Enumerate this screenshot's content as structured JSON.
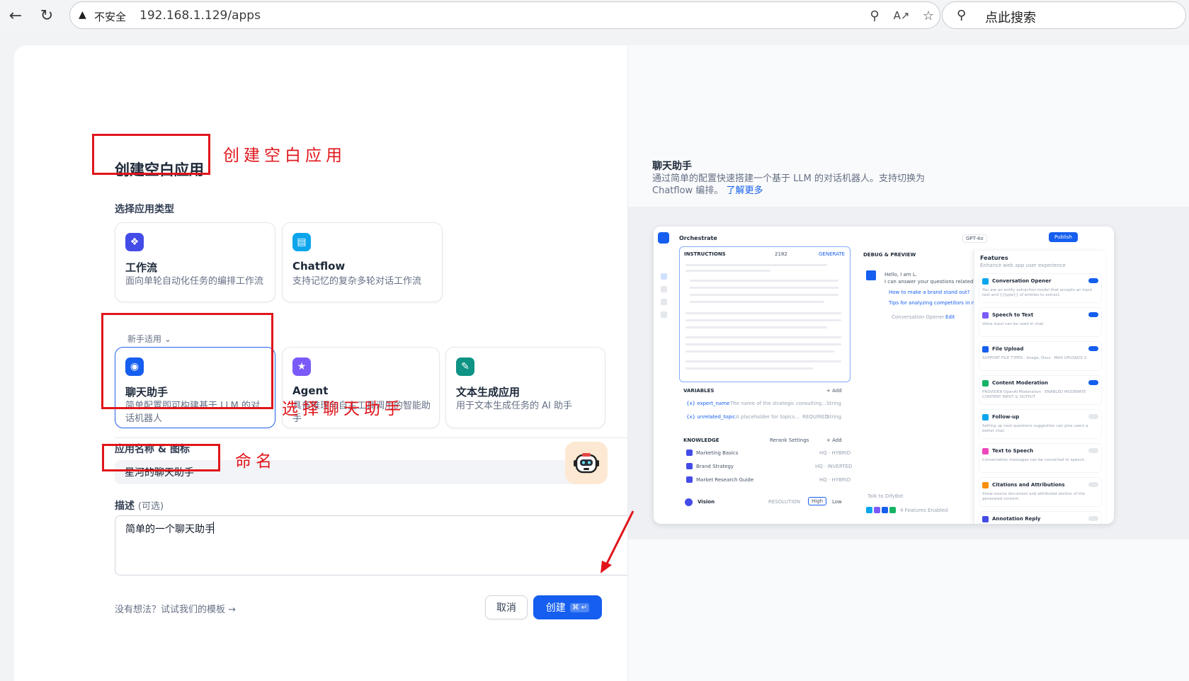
{
  "browser": {
    "insecure_label": "不安全",
    "url": "192.168.1.129/apps",
    "search_placeholder": "点此搜索"
  },
  "dialog": {
    "title": "创建空白应用",
    "app_type_label": "选择应用类型",
    "beginner_label": "新手适用",
    "top_types": [
      {
        "name": "工作流",
        "desc": "面向单轮自动化任务的编排工作流",
        "color": "#444ce7"
      },
      {
        "name": "Chatflow",
        "desc": "支持记忆的复杂多轮对话工作流",
        "color": "#0ba5ec"
      }
    ],
    "beginner_types": [
      {
        "name": "聊天助手",
        "desc": "简单配置即可构建基于 LLM 的对话机器人",
        "color": "#155eef"
      },
      {
        "name": "Agent",
        "desc": "具备推理与自主工具调用的智能助手",
        "color": "#7a5af8"
      },
      {
        "name": "文本生成应用",
        "desc": "用于文本生成任务的 AI 助手",
        "color": "#0e9384"
      }
    ],
    "name_label": "应用名称 & 图标",
    "name_value": "星河的聊天助手",
    "desc_label": "描述",
    "desc_optional": "(可选)",
    "desc_value": "简单的一个聊天助手",
    "template_link": "没有想法？试试我们的模板 →",
    "cancel_label": "取消",
    "create_label": "创建",
    "create_shortcut": "⌘ ↵"
  },
  "annotations": {
    "title_note": "创建空白应用",
    "select_note": "选择聊天助手",
    "name_note": "命名"
  },
  "preview": {
    "title": "聊天助手",
    "desc": "通过简单的配置快速搭建一个基于 LLM 的对话机器人。支持切换为 Chatflow 编排。",
    "learn_more": "了解更多",
    "shot": {
      "orchestrate": "Orchestrate",
      "model": "GPT-4o",
      "publish": "Publish",
      "instructions": "INSTRUCTIONS",
      "token_count": "2182",
      "generate": "GENERATE",
      "debug": "DEBUG & PREVIEW",
      "greeting": "Hello, I am L.",
      "greeting2": "I can answer your questions related",
      "suggest1": "How to make a brand stand out?",
      "suggest2": "Tips for analyzing competitors in market",
      "opener": "Conversation Opener",
      "edit": "Edit",
      "variables": "VARIABLES",
      "add": "+ Add",
      "var1": "{x} expert_name",
      "var1_desc": "The name of the strategic consulting...",
      "var2": "{x} unrelated_topic",
      "var2_desc": "A placeholder for topics...",
      "required": "REQUIRED",
      "string_type": "String",
      "knowledge": "KNOWLEDGE",
      "rerank": "Rerank Settings",
      "kb": [
        "Marketing Basics",
        "Brand Strategy",
        "Market Research Guide"
      ],
      "kb_tags": [
        "HQ · HYBRID",
        "HQ · INVERTED",
        "HQ · HYBRID"
      ],
      "vision": "Vision",
      "resolution": "RESOLUTION",
      "high": "High",
      "low": "Low",
      "talk": "Talk to DifyBot",
      "features_enabled": "4 Features Enabled",
      "features": "Features",
      "features_sub": "Enhance web app user experience",
      "feature_list": [
        {
          "name": "Conversation Opener",
          "desc": "You are an entity extraction model that accepts an input text and {{type}} of entities to extract.",
          "color": "#0ba5ec",
          "on": true
        },
        {
          "name": "Speech to Text",
          "desc": "Voice input can be used in chat.",
          "color": "#7a5af8",
          "on": true
        },
        {
          "name": "File Upload",
          "desc": "SUPPORT FILE TYPES · Image, Docs · MAX UPLOADS 3",
          "color": "#155eef",
          "on": true
        },
        {
          "name": "Content Moderation",
          "desc": "PROVIDER OpenAI Moderation · ENABLED MODERATE CONTENT INPUT & OUTPUT",
          "color": "#16b364",
          "on": true
        },
        {
          "name": "Follow-up",
          "desc": "Setting up next questions suggestion can give users a better chat.",
          "color": "#0ba5ec",
          "on": false
        },
        {
          "name": "Text to Speech",
          "desc": "Conversation messages can be converted to speech.",
          "color": "#ee46bc",
          "on": false
        },
        {
          "name": "Citations and Attributions",
          "desc": "Show source document and attributed section of the generated content.",
          "color": "#f79009",
          "on": false
        },
        {
          "name": "Annotation Reply",
          "desc": "",
          "color": "#444ce7",
          "on": false
        }
      ]
    }
  }
}
